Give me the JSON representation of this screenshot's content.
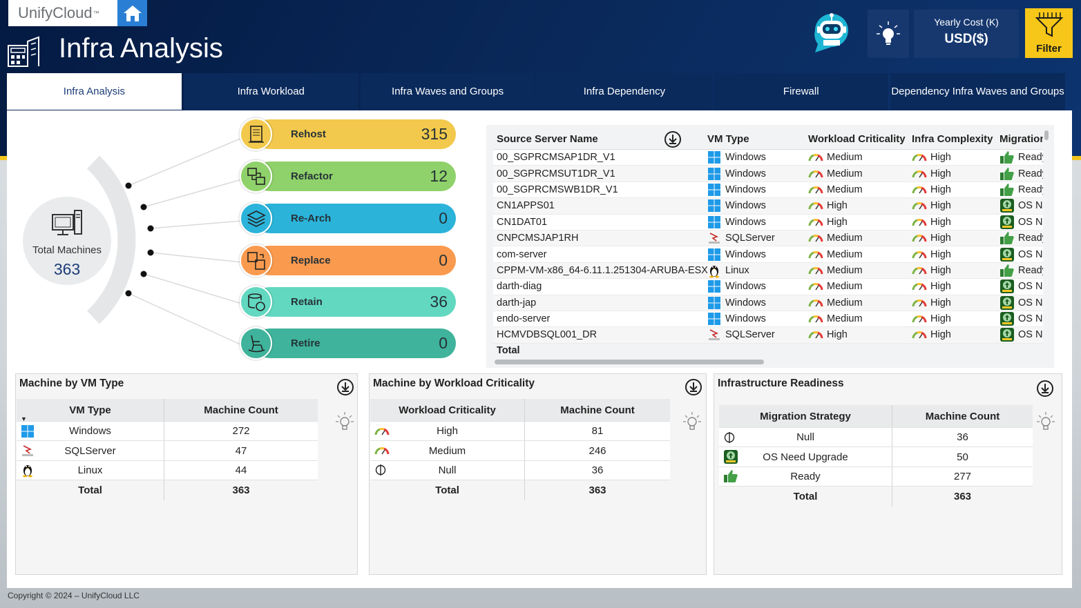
{
  "header": {
    "brand": "UnifyCloud",
    "brand_tm": "™",
    "title": "Infra Analysis",
    "cost_label": "Yearly Cost (K)",
    "cost_currency": "USD($)",
    "filter_label": "Filter"
  },
  "tabs": [
    {
      "label": "Infra Analysis",
      "active": true
    },
    {
      "label": "Infra Workload",
      "active": false
    },
    {
      "label": "Infra Waves and Groups",
      "active": false
    },
    {
      "label": "Infra Dependency",
      "active": false
    },
    {
      "label": "Firewall",
      "active": false
    },
    {
      "label": "Dependency Infra Waves and Groups",
      "active": false
    }
  ],
  "summary": {
    "total_label": "Total Machines",
    "total_value": "363"
  },
  "strategies": [
    {
      "name": "Rehost",
      "value": "315",
      "color": "#f2c94c",
      "icon_color": "#f2c94c"
    },
    {
      "name": "Refactor",
      "value": "12",
      "color": "#8fd16a",
      "icon_color": "#8fd16a"
    },
    {
      "name": "Re-Arch",
      "value": "0",
      "color": "#2bb3d9",
      "icon_color": "#2bb3d9"
    },
    {
      "name": "Replace",
      "value": "0",
      "color": "#f99a4e",
      "icon_color": "#f99a4e"
    },
    {
      "name": "Retain",
      "value": "36",
      "color": "#62d8c1",
      "icon_color": "#62d8c1"
    },
    {
      "name": "Retire",
      "value": "0",
      "color": "#3fb39b",
      "icon_color": "#3fb39b"
    }
  ],
  "server_table": {
    "headers": [
      "Source Server Name",
      "VM Type",
      "Workload Criticality",
      "Infra Complexity",
      "Migration"
    ],
    "rows": [
      {
        "name": "00_SGPRCMSAP1DR_V1",
        "vm": "Windows",
        "wc": "Medium",
        "ic": "High",
        "mg": "Ready",
        "mg_icon": "thumbs-up-icon"
      },
      {
        "name": "00_SGPRCMSUT1DR_V1",
        "vm": "Windows",
        "wc": "Medium",
        "ic": "High",
        "mg": "Ready",
        "mg_icon": "thumbs-up-icon"
      },
      {
        "name": "00_SGPRCMSWB1DR_V1",
        "vm": "Windows",
        "wc": "Medium",
        "ic": "High",
        "mg": "Ready",
        "mg_icon": "thumbs-up-icon"
      },
      {
        "name": "CN1APPS01",
        "vm": "Windows",
        "wc": "High",
        "ic": "High",
        "mg": "OS Need Upgrade",
        "mg_icon": "upgrade-icon"
      },
      {
        "name": "CN1DAT01",
        "vm": "Windows",
        "wc": "High",
        "ic": "High",
        "mg": "OS Need Upgrade",
        "mg_icon": "upgrade-icon"
      },
      {
        "name": "CNPCMSJAP1RH",
        "vm": "SQLServer",
        "wc": "Medium",
        "ic": "High",
        "mg": "Ready",
        "mg_icon": "thumbs-up-icon"
      },
      {
        "name": "com-server",
        "vm": "Windows",
        "wc": "Medium",
        "ic": "High",
        "mg": "OS Need Upgrade",
        "mg_icon": "upgrade-icon"
      },
      {
        "name": "CPPM-VM-x86_64-6.11.1.251304-ARUBA-ESX",
        "vm": "Linux",
        "wc": "Medium",
        "ic": "High",
        "mg": "Ready",
        "mg_icon": "thumbs-up-icon"
      },
      {
        "name": "darth-diag",
        "vm": "Windows",
        "wc": "Medium",
        "ic": "High",
        "mg": "OS Need Upgrade",
        "mg_icon": "upgrade-icon"
      },
      {
        "name": "darth-jap",
        "vm": "Windows",
        "wc": "Medium",
        "ic": "High",
        "mg": "OS Need Upgrade",
        "mg_icon": "upgrade-icon"
      },
      {
        "name": "endo-server",
        "vm": "Windows",
        "wc": "Medium",
        "ic": "High",
        "mg": "OS Need Upgrade",
        "mg_icon": "upgrade-icon"
      },
      {
        "name": "HCMVDBSQL001_DR",
        "vm": "SQLServer",
        "wc": "High",
        "ic": "High",
        "mg": "OS Need Upgrade",
        "mg_icon": "upgrade-icon"
      }
    ],
    "total_label": "Total"
  },
  "cards": {
    "vm_type": {
      "title": "Machine by VM Type",
      "headers": [
        "VM Type",
        "Machine Count"
      ],
      "rows": [
        {
          "label": "Windows",
          "count": "272",
          "icon": "windows-icon"
        },
        {
          "label": "SQLServer",
          "count": "47",
          "icon": "sqlserver-icon"
        },
        {
          "label": "Linux",
          "count": "44",
          "icon": "linux-icon"
        }
      ],
      "total_label": "Total",
      "total_value": "363"
    },
    "workload": {
      "title": "Machine by Workload Criticality",
      "headers": [
        "Workload Criticality",
        "Machine Count"
      ],
      "rows": [
        {
          "label": "High",
          "count": "81",
          "icon": "gauge-icon"
        },
        {
          "label": "Medium",
          "count": "246",
          "icon": "gauge-icon"
        },
        {
          "label": "Null",
          "count": "36",
          "icon": "null-icon"
        }
      ],
      "total_label": "Total",
      "total_value": "363"
    },
    "readiness": {
      "title": "Infrastructure Readiness",
      "headers": [
        "Migration Strategy",
        "Machine Count"
      ],
      "rows": [
        {
          "label": "Null",
          "count": "36",
          "icon": "null-icon"
        },
        {
          "label": "OS Need Upgrade",
          "count": "50",
          "icon": "upgrade-icon"
        },
        {
          "label": "Ready",
          "count": "277",
          "icon": "thumbs-up-icon"
        }
      ],
      "total_label": "Total",
      "total_value": "363"
    }
  },
  "footer": {
    "copyright": "Copyright © 2024 – UnifyCloud LLC"
  }
}
